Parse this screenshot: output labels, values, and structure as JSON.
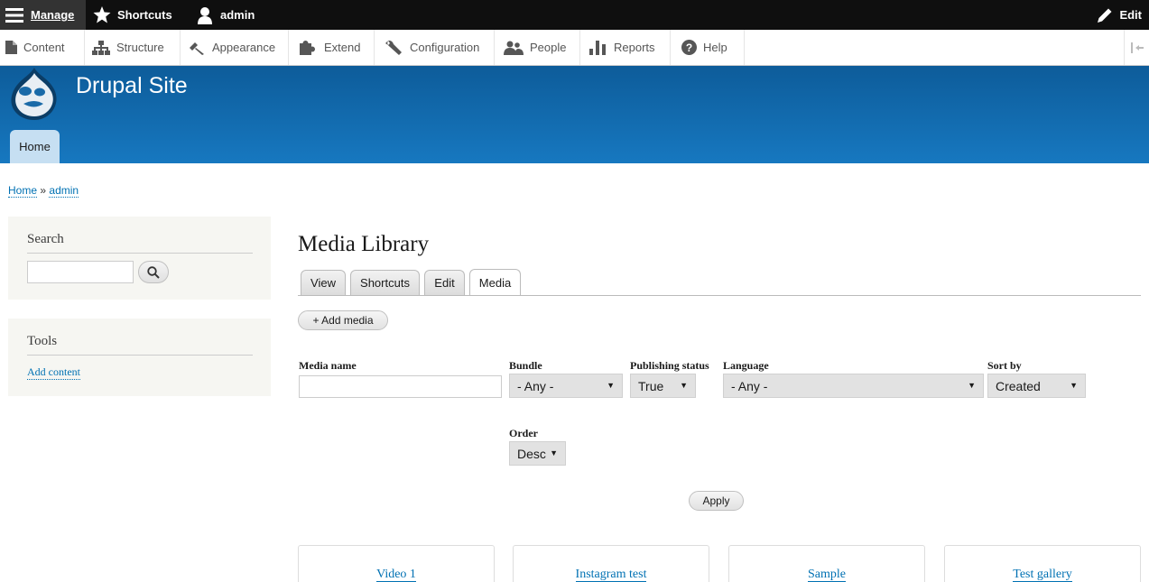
{
  "toolbar": {
    "manage": "Manage",
    "shortcuts": "Shortcuts",
    "user": "admin",
    "edit": "Edit"
  },
  "tray": {
    "items": [
      {
        "label": "Content",
        "icon": "file-icon"
      },
      {
        "label": "Structure",
        "icon": "sitemap-icon"
      },
      {
        "label": "Appearance",
        "icon": "paintbrush-icon"
      },
      {
        "label": "Extend",
        "icon": "puzzle-icon"
      },
      {
        "label": "Configuration",
        "icon": "wrench-icon"
      },
      {
        "label": "People",
        "icon": "people-icon"
      },
      {
        "label": "Reports",
        "icon": "bar-chart-icon"
      },
      {
        "label": "Help",
        "icon": "help-icon"
      }
    ],
    "toggle_icon": "orientation-toggle-icon"
  },
  "header": {
    "site_name": "Drupal Site",
    "home_tab": "Home"
  },
  "breadcrumb": {
    "items": [
      "Home",
      "admin"
    ],
    "separator": "»"
  },
  "sidebar": {
    "search_title": "Search",
    "tools_title": "Tools",
    "tools_link": "Add content"
  },
  "main": {
    "title": "Media Library",
    "tabs": [
      "View",
      "Shortcuts",
      "Edit",
      "Media"
    ],
    "active_tab": "Media",
    "add_media": "+ Add media",
    "filters": {
      "media_name_label": "Media name",
      "media_name_value": "",
      "bundle_label": "Bundle",
      "bundle_value": "- Any -",
      "status_label": "Publishing status",
      "status_value": "True",
      "language_label": "Language",
      "language_value": "- Any -",
      "sort_label": "Sort by",
      "sort_value": "Created",
      "order_label": "Order",
      "order_value": "Desc"
    },
    "apply": "Apply",
    "media_items": [
      "Video 1",
      "Instagram test",
      "Sample",
      "Test gallery"
    ]
  },
  "colors": {
    "toolbar_bg": "#0f0f0f",
    "header_blue": "#1778c0",
    "link": "#0071b3",
    "sidebar_bg": "#f6f6f2"
  }
}
